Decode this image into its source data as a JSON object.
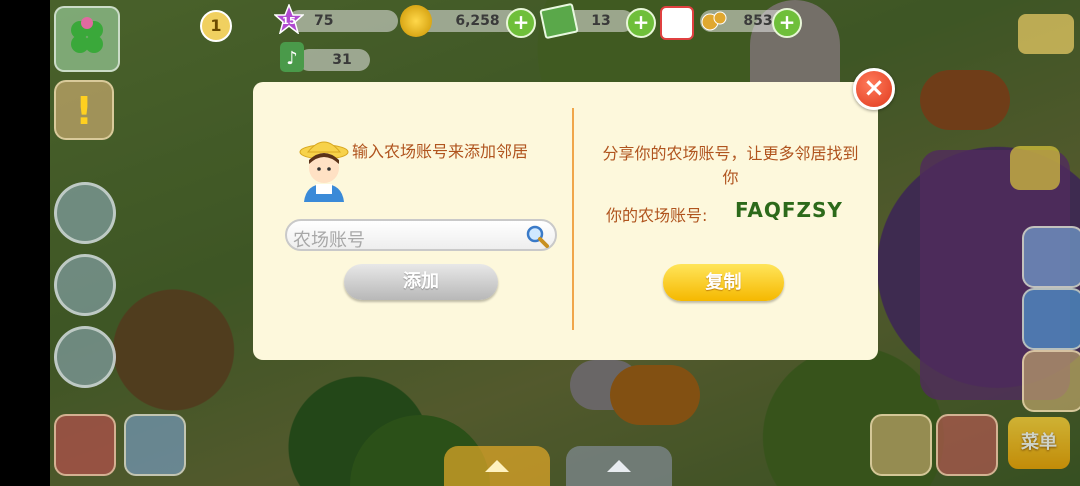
{
  "hud": {
    "level": "15",
    "xp": "75",
    "coins": "6,258",
    "cash": "13",
    "parts": "853",
    "notes": "31",
    "timer_badge": "1"
  },
  "dialog": {
    "left_instruction": "输入农场账号来添加邻居",
    "search_placeholder": "农场账号",
    "add_label": "添加",
    "right_instruction": "分享你的农场账号，让更多邻居找到你",
    "account_label": "你的农场账号:",
    "account_value": "FAQFZSY",
    "copy_label": "复制"
  },
  "bottom": {
    "menu_label": "菜单"
  },
  "icons": [
    "clover-icon",
    "star-level-icon",
    "coin-icon",
    "cash-icon",
    "gear-parts-icon",
    "music-note-icon",
    "close-icon",
    "farmer-avatar-icon",
    "magnifier-icon",
    "barn-icon",
    "chat-icon",
    "gift-icon",
    "settings-icon",
    "handshake-icon",
    "hammer-icon",
    "shop-icon"
  ],
  "colors": {
    "dialog_bg": "#fdf8dc",
    "text_brown": "#b0541e",
    "account_green": "#2c6a1a",
    "copy_yellow": "#f5b800",
    "close_red": "#e03a1e"
  }
}
